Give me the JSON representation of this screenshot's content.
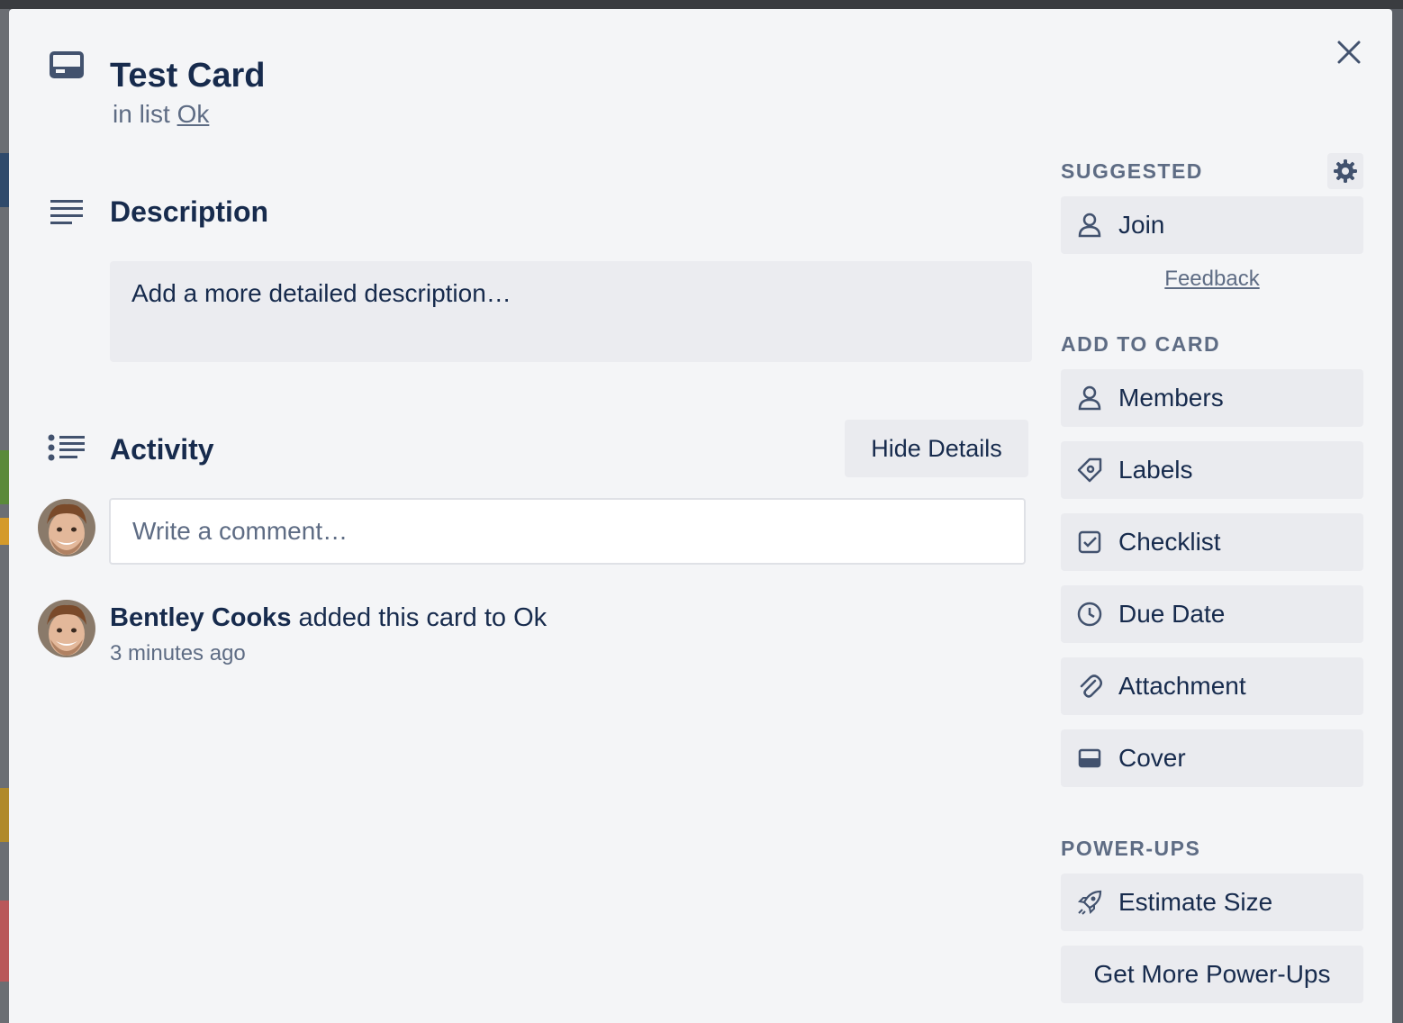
{
  "card": {
    "title": "Test Card",
    "in_list_prefix": "in list",
    "list_name": "Ok"
  },
  "description": {
    "heading": "Description",
    "placeholder": "Add a more detailed description…"
  },
  "activity": {
    "heading": "Activity",
    "hide_details_label": "Hide Details",
    "comment_placeholder": "Write a comment…",
    "entries": [
      {
        "user": "Bentley Cooks",
        "action": "added this card to Ok",
        "time": "3 minutes ago"
      }
    ]
  },
  "sidebar": {
    "suggested_heading": "SUGGESTED",
    "join_label": "Join",
    "feedback_label": "Feedback",
    "add_to_card_heading": "ADD TO CARD",
    "add_to_card": [
      {
        "label": "Members",
        "icon": "person-icon"
      },
      {
        "label": "Labels",
        "icon": "tag-icon"
      },
      {
        "label": "Checklist",
        "icon": "checkbox-icon"
      },
      {
        "label": "Due Date",
        "icon": "clock-icon"
      },
      {
        "label": "Attachment",
        "icon": "paperclip-icon"
      },
      {
        "label": "Cover",
        "icon": "cover-icon"
      }
    ],
    "power_ups_heading": "POWER-UPS",
    "estimate_size_label": "Estimate Size",
    "get_more_label": "Get More Power-Ups"
  },
  "colors": {
    "text_primary": "#172b4d",
    "text_secondary": "#5e6c84",
    "button_bg": "#eaebef",
    "modal_bg": "#f4f5f7"
  }
}
